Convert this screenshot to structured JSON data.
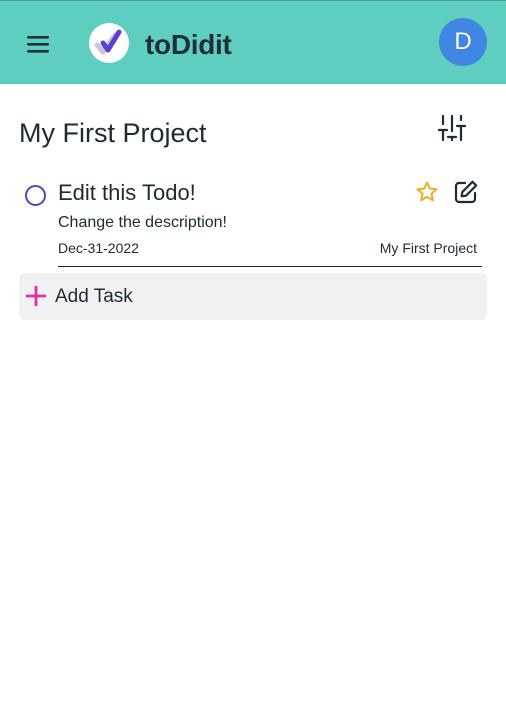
{
  "app": {
    "title": "toDidit",
    "user_initial": "D",
    "colors": {
      "header_bg": "#5ecec1",
      "avatar_bg": "#3f87e3",
      "checkbox": "#5a3fd6",
      "star": "#e8b21e",
      "add_icon": "#e0329a"
    }
  },
  "header": {
    "menu_icon": "hamburger-menu-icon",
    "logo_icon": "check-logo-icon"
  },
  "project": {
    "title": "My First Project",
    "filter_icon": "sliders-icon"
  },
  "tasks": [
    {
      "title": "Edit this Todo!",
      "description": "Change the description!",
      "due_date": "Dec-31-2022",
      "project": "My First Project",
      "completed": false,
      "starred": false
    }
  ],
  "add_task": {
    "label": "Add Task",
    "icon": "plus-icon"
  }
}
